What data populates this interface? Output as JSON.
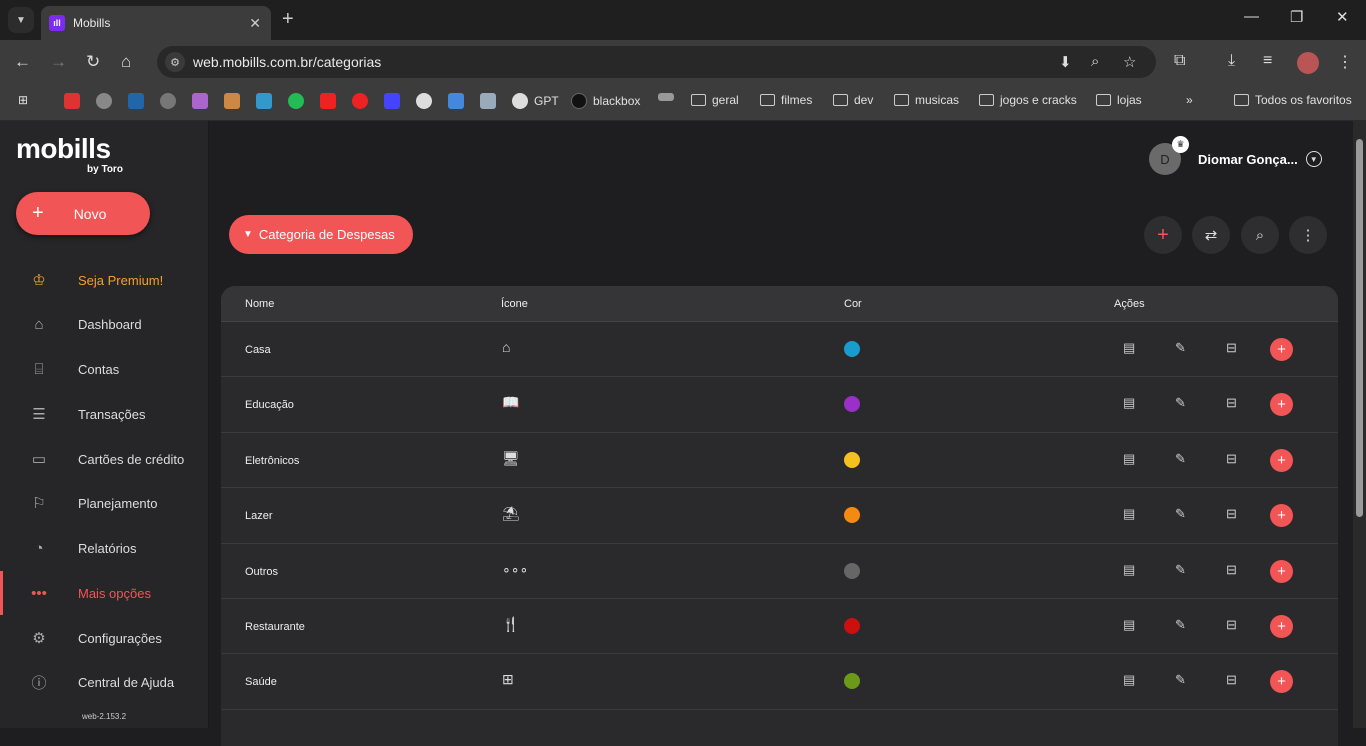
{
  "browser": {
    "tab_title": "Mobills",
    "url": "web.mobills.com.br/categorias",
    "bookmarks": [
      "GPT",
      "blackbox",
      "geral",
      "filmes",
      "dev",
      "musicas",
      "jogos e cracks",
      "lojas"
    ],
    "all_favorites": "Todos os favoritos"
  },
  "app": {
    "logo": "mobills",
    "logo_sub": "by Toro",
    "new_button": "Novo",
    "nav": [
      {
        "label": "Seja Premium!",
        "icon": "crown-icon"
      },
      {
        "label": "Dashboard",
        "icon": "home-icon"
      },
      {
        "label": "Contas",
        "icon": "bank-icon"
      },
      {
        "label": "Transações",
        "icon": "list-icon"
      },
      {
        "label": "Cartões de crédito",
        "icon": "credit-card-icon"
      },
      {
        "label": "Planejamento",
        "icon": "flag-icon"
      },
      {
        "label": "Relatórios",
        "icon": "pie-chart-icon"
      },
      {
        "label": "Mais opções",
        "icon": "more-icon"
      },
      {
        "label": "Configurações",
        "icon": "gear-icon"
      },
      {
        "label": "Central de Ajuda",
        "icon": "help-icon"
      }
    ],
    "version": "web-2.153.2",
    "user_initial": "D",
    "user_name": "Diomar Gonça...",
    "category_button": "Categoria de Despesas",
    "accent": "#f25555",
    "premium_color": "#f0a030"
  },
  "table": {
    "headers": {
      "name": "Nome",
      "icon": "Ícone",
      "color": "Cor",
      "actions": "Ações"
    },
    "rows": [
      {
        "name": "Casa",
        "icon": "⌂",
        "color": "#1a9bd0"
      },
      {
        "name": "Educação",
        "icon": "📖",
        "color": "#9b30c8"
      },
      {
        "name": "Eletrônicos",
        "icon": "🖥",
        "color": "#f5c120"
      },
      {
        "name": "Lazer",
        "icon": "⛱",
        "color": "#f58a10"
      },
      {
        "name": "Outros",
        "icon": "∘∘∘",
        "color": "#666666"
      },
      {
        "name": "Restaurante",
        "icon": "🍴",
        "color": "#cc1010"
      },
      {
        "name": "Saúde",
        "icon": "⊞",
        "color": "#6a9a18"
      }
    ]
  }
}
